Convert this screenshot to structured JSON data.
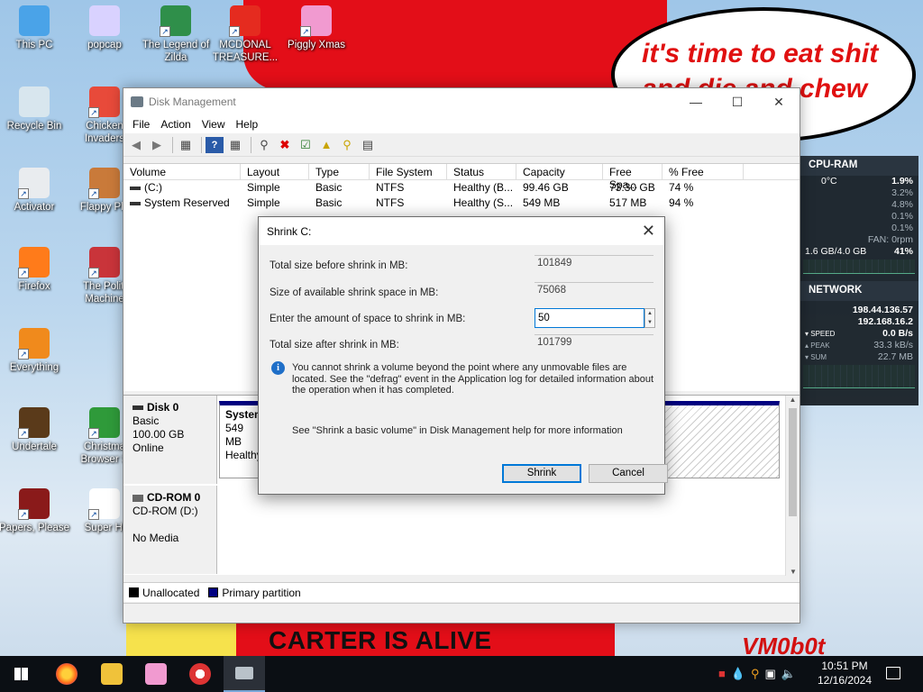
{
  "wallpaper": {
    "bubble_text": "it's time to eat shit and die and chew es",
    "bottom_banner": "CARTER IS ALIVE",
    "signature": "VM0b0t"
  },
  "desktop_icons": [
    {
      "label": "This PC",
      "color": "#4aa3e8"
    },
    {
      "label": "popcap",
      "color": "#d9d2ff"
    },
    {
      "label": "The Legend of Zilda",
      "color": "#2f8f4a"
    },
    {
      "label": "MCDONAL TREASURE...",
      "color": "#e52b1f"
    },
    {
      "label": "Piggly Xmas",
      "color": "#f19ad0"
    },
    {
      "label": "Recycle Bin",
      "color": "#d8e6ee"
    },
    {
      "label": "Chicken Invaders",
      "color": "#e84a3a"
    },
    {
      "label": "Activator",
      "color": "#e9ecef"
    },
    {
      "label": "Flappy Pla",
      "color": "#c97a3a"
    },
    {
      "label": "Firefox",
      "color": "#ff7b1a"
    },
    {
      "label": "The Politi Machine",
      "color": "#c9343a"
    },
    {
      "label": "Everything",
      "color": "#f08a1c"
    },
    {
      "label": "Undertale",
      "color": "#5a3a1a"
    },
    {
      "label": "Christma Browser S",
      "color": "#2f9a3a"
    },
    {
      "label": "Papers, Please",
      "color": "#8a1a1a"
    },
    {
      "label": "Super Hi",
      "color": "#ffffff"
    }
  ],
  "widget": {
    "cpu_title": "CPU-RAM",
    "temp": "0°C",
    "cpu_pct": "1.9%",
    "cores": [
      "3.2%",
      "4.8%",
      "0.1%",
      "0.1%"
    ],
    "fan": "FAN: 0rpm",
    "ram": "1.6 GB/4.0 GB",
    "ram_pct": "41%",
    "net_title": "NETWORK",
    "ip1": "198.44.136.57",
    "ip2": "192.168.16.2",
    "speed_label": "SPEED",
    "speed": "0.0 B/s",
    "peak_label": "PEAK",
    "peak": "33.3 kB/s",
    "sum_label": "SUM",
    "sum": "22.7 MB"
  },
  "window": {
    "title": "Disk Management",
    "menu": [
      "File",
      "Action",
      "View",
      "Help"
    ],
    "columns": [
      "Volume",
      "Layout",
      "Type",
      "File System",
      "Status",
      "Capacity",
      "Free Spa...",
      "% Free"
    ],
    "rows": [
      [
        "(C:)",
        "Simple",
        "Basic",
        "NTFS",
        "Healthy (B...",
        "99.46 GB",
        "73.30 GB",
        "74 %"
      ],
      [
        "System Reserved",
        "Simple",
        "Basic",
        "NTFS",
        "Healthy (S...",
        "549 MB",
        "517 MB",
        "94 %"
      ]
    ],
    "disk0": {
      "name": "Disk 0",
      "type": "Basic",
      "size": "100.00 GB",
      "state": "Online"
    },
    "disk0_part": {
      "name": "System",
      "size": "549 MB",
      "status": "Healthy"
    },
    "cdrom": {
      "name": "CD-ROM 0",
      "drive": "CD-ROM (D:)",
      "media": "No Media"
    },
    "legend": [
      "Unallocated",
      "Primary partition"
    ]
  },
  "dialog": {
    "title": "Shrink C:",
    "label_total": "Total size before shrink in MB:",
    "value_total": "101849",
    "label_available": "Size of available shrink space in MB:",
    "value_available": "75068",
    "label_amount": "Enter the amount of space to shrink in MB:",
    "value_amount": "50",
    "label_after": "Total size after shrink in MB:",
    "value_after": "101799",
    "info": "You cannot shrink a volume beyond the point where any unmovable files are located. See the \"defrag\" event in the Application log for detailed information about the operation when it has completed.",
    "help": "See \"Shrink a basic volume\" in Disk Management help for more information",
    "shrink_button": "Shrink",
    "cancel_button": "Cancel"
  },
  "taskbar": {
    "time": "10:51 PM",
    "date": "12/16/2024"
  },
  "colors": {
    "primary_partition": "#000080",
    "unallocated": "#000000",
    "accent": "#0078d7"
  }
}
